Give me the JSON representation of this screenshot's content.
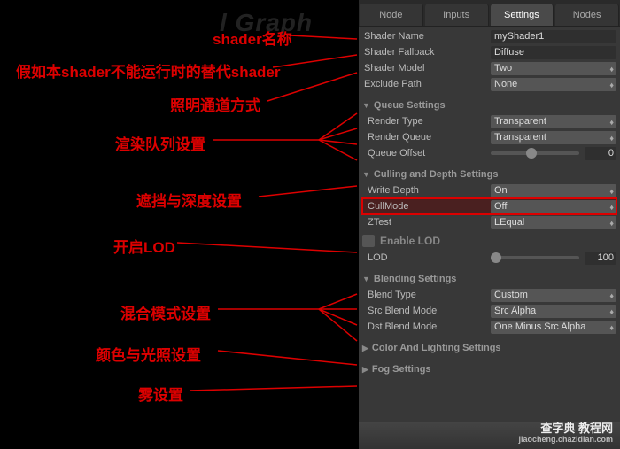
{
  "bg_text": "l Graph",
  "tabs": {
    "node": "Node",
    "inputs": "Inputs",
    "settings": "Settings",
    "nodes": "Nodes"
  },
  "fields": {
    "shader_name_label": "Shader Name",
    "shader_name_value": "myShader1",
    "shader_fallback_label": "Shader Fallback",
    "shader_fallback_value": "Diffuse",
    "shader_model_label": "Shader Model",
    "shader_model_value": "Two",
    "exclude_path_label": "Exclude Path",
    "exclude_path_value": "None",
    "queue_section": "Queue Settings",
    "render_type_label": "Render Type",
    "render_type_value": "Transparent",
    "render_queue_label": "Render Queue",
    "render_queue_value": "Transparent",
    "queue_offset_label": "Queue Offset",
    "queue_offset_value": "0",
    "culling_section": "Culling and Depth Settings",
    "write_depth_label": "Write Depth",
    "write_depth_value": "On",
    "cullmode_label": "CullMode",
    "cullmode_value": "Off",
    "ztest_label": "ZTest",
    "ztest_value": "LEqual",
    "enable_lod_label": "Enable LOD",
    "lod_label": "LOD",
    "lod_value": "100",
    "blending_section": "Blending Settings",
    "blend_type_label": "Blend Type",
    "blend_type_value": "Custom",
    "src_blend_label": "Src Blend Mode",
    "src_blend_value": "Src Alpha",
    "dst_blend_label": "Dst Blend Mode",
    "dst_blend_value": "One Minus Src Alpha",
    "color_section": "Color And Lighting Settings",
    "fog_section": "Fog Settings"
  },
  "annotations": {
    "shader_name": "shader名称",
    "fallback": "假如本shader不能运行时的替代shader",
    "model": "照明通道方式",
    "queue": "渲染队列设置",
    "culling": "遮挡与深度设置",
    "lod": "开启LOD",
    "blending": "混合模式设置",
    "color": "颜色与光照设置",
    "fog": "雾设置"
  },
  "watermark": {
    "main": "查字典  教程网",
    "sub": "jiaocheng.chazidian.com"
  }
}
